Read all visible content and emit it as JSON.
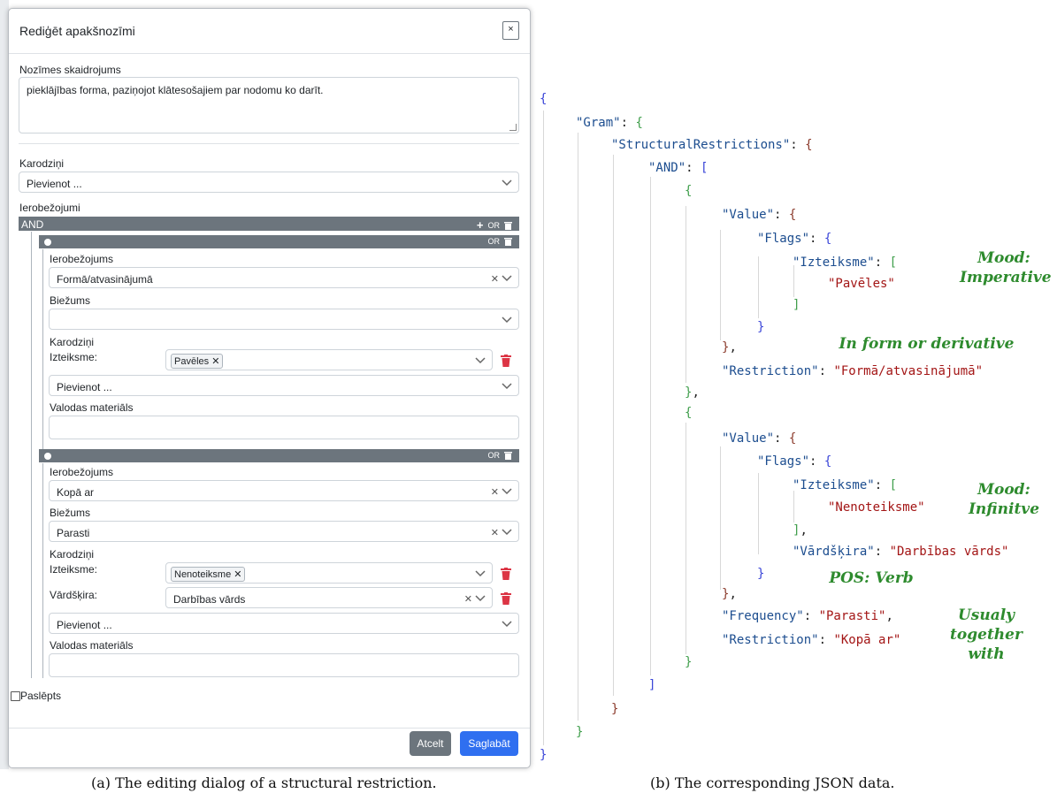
{
  "dialog": {
    "title": "Rediģēt apakšnozīmi",
    "close_label": "×",
    "gloss_label": "Nozīmes skaidrojums",
    "gloss_value": "pieklājības forma, paziņojot klātesošajiem par nodomu ko darīt.",
    "flags_label": "Karodziņi",
    "flags_placeholder": "Pievienot ...",
    "restrictions_label": "Ierobežojumi",
    "and_label": "AND",
    "or_label": "OR",
    "plus_label": "+",
    "restriction1": {
      "restriction_label": "Ierobežojums",
      "restriction_value": "Formā/atvasinājumā",
      "frequency_label": "Biežums",
      "frequency_value": "",
      "flags_label": "Karodziņi",
      "mood_label": "Izteiksme:",
      "mood_value": "Pavēles",
      "add_placeholder": "Pievienot ...",
      "material_label": "Valodas materiāls",
      "material_value": ""
    },
    "restriction2": {
      "restriction_label": "Ierobežojums",
      "restriction_value": "Kopā ar",
      "frequency_label": "Biežums",
      "frequency_value": "Parasti",
      "flags_label": "Karodziņi",
      "mood_label": "Izteiksme:",
      "mood_value": "Nenoteiksme",
      "pos_label": "Vārdšķira:",
      "pos_value": "Darbības vārds",
      "add_placeholder": "Pievienot ...",
      "material_label": "Valodas materiāls",
      "material_value": ""
    },
    "hidden_label": "Paslēpts",
    "cancel_label": "Atcelt",
    "save_label": "Saglabāt"
  },
  "json_lines": {
    "l1": "{",
    "gram_key": "\"Gram\"",
    "sr_key": "\"StructuralRestrictions\"",
    "and_key": "\"AND\"",
    "value_key": "\"Value\"",
    "flags_key": "\"Flags\"",
    "izteiksme_key": "\"Izteiksme\"",
    "paveles": "\"Pavēles\"",
    "restriction_key": "\"Restriction\"",
    "restriction1_val": "\"Formā/atvasinājumā\"",
    "nenoteiksme": "\"Nenoteiksme\"",
    "vardskira_key": "\"Vārdšķira\"",
    "vardskira_val": "\"Darbības vārds\"",
    "frequency_key": "\"Frequency\"",
    "frequency_val": "\"Parasti\"",
    "restriction2_val": "\"Kopā ar\""
  },
  "annotations": {
    "mood_imperative_1": "Mood:",
    "mood_imperative_2": "Imperative",
    "in_form": "In form or derivative",
    "mood_infinitive_1": "Mood:",
    "mood_infinitive_2": "Infinitve",
    "pos_verb": "POS: Verb",
    "usually_1": "Usualy",
    "usually_2": "together",
    "usually_3": "with"
  },
  "captions": {
    "a": "(a) The editing dialog of a structural restriction.",
    "b": "(b) The corresponding JSON data."
  },
  "colors": {
    "primary": "#2f6ff0",
    "secondary": "#6c757d",
    "danger": "#dc3545",
    "annotation": "#2e8b2e"
  }
}
